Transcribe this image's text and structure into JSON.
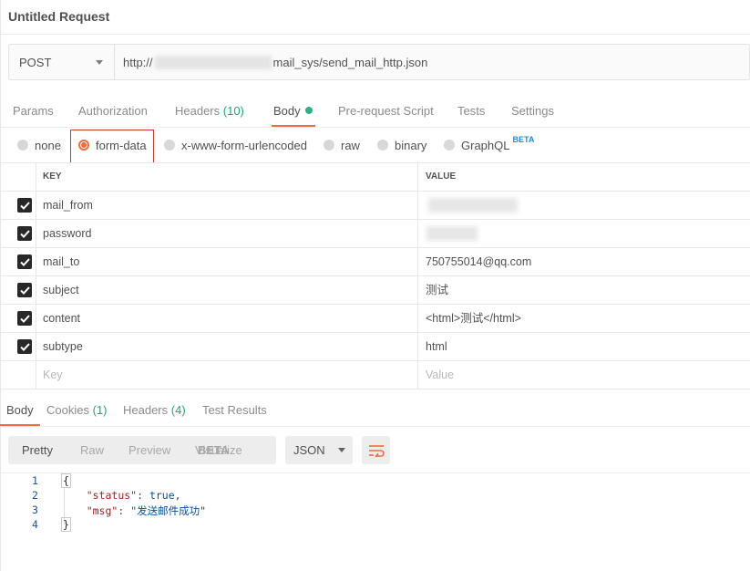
{
  "window": {
    "title": "Untitled Request"
  },
  "request": {
    "method": "POST",
    "url_prefix": "http://",
    "url_suffix": "mail_sys/send_mail_http.json"
  },
  "tabs": [
    {
      "label": "Params"
    },
    {
      "label": "Authorization"
    },
    {
      "label": "Headers",
      "count": "(10)"
    },
    {
      "label": "Body",
      "active": true
    },
    {
      "label": "Pre-request Script"
    },
    {
      "label": "Tests"
    },
    {
      "label": "Settings"
    }
  ],
  "body_types": [
    {
      "label": "none"
    },
    {
      "label": "form-data",
      "selected": true
    },
    {
      "label": "x-www-form-urlencoded"
    },
    {
      "label": "raw"
    },
    {
      "label": "binary"
    },
    {
      "label": "GraphQL",
      "badge": "BETA"
    }
  ],
  "table": {
    "headers": {
      "key": "KEY",
      "value": "VALUE"
    },
    "rows": [
      {
        "key": "mail_from",
        "value": ""
      },
      {
        "key": "password",
        "value": ""
      },
      {
        "key": "mail_to",
        "value": "750755014@qq.com"
      },
      {
        "key": "subject",
        "value": "测试"
      },
      {
        "key": "content",
        "value": "<html>测试</html>"
      },
      {
        "key": "subtype",
        "value": "html"
      }
    ],
    "placeholder": {
      "key": "Key",
      "value": "Value"
    }
  },
  "response_tabs": [
    {
      "label": "Body",
      "active": true
    },
    {
      "label": "Cookies",
      "count": "(1)"
    },
    {
      "label": "Headers",
      "count": "(4)"
    },
    {
      "label": "Test Results"
    }
  ],
  "view_modes": [
    {
      "label": "Pretty",
      "active": true
    },
    {
      "label": "Raw"
    },
    {
      "label": "Preview"
    },
    {
      "label": "Visualize",
      "badge": "BETA"
    }
  ],
  "format": {
    "selected": "JSON"
  },
  "response_code": {
    "line_numbers": [
      "1",
      "2",
      "3",
      "4"
    ],
    "open_brace": "{",
    "close_brace": "}",
    "status_key": "\"status\"",
    "status_value": "true",
    "msg_key": "\"msg\"",
    "msg_value": "\"发送邮件成功\""
  },
  "colors": {
    "accent": "#f26b3a",
    "active_dot": "#26b47f",
    "count": "#20a870",
    "beta": "#1a8fe3",
    "highlight_box": "#d9342b"
  },
  "icons": [
    "caret-down-icon",
    "checkbox-checked-icon",
    "wrap-lines-icon"
  ]
}
